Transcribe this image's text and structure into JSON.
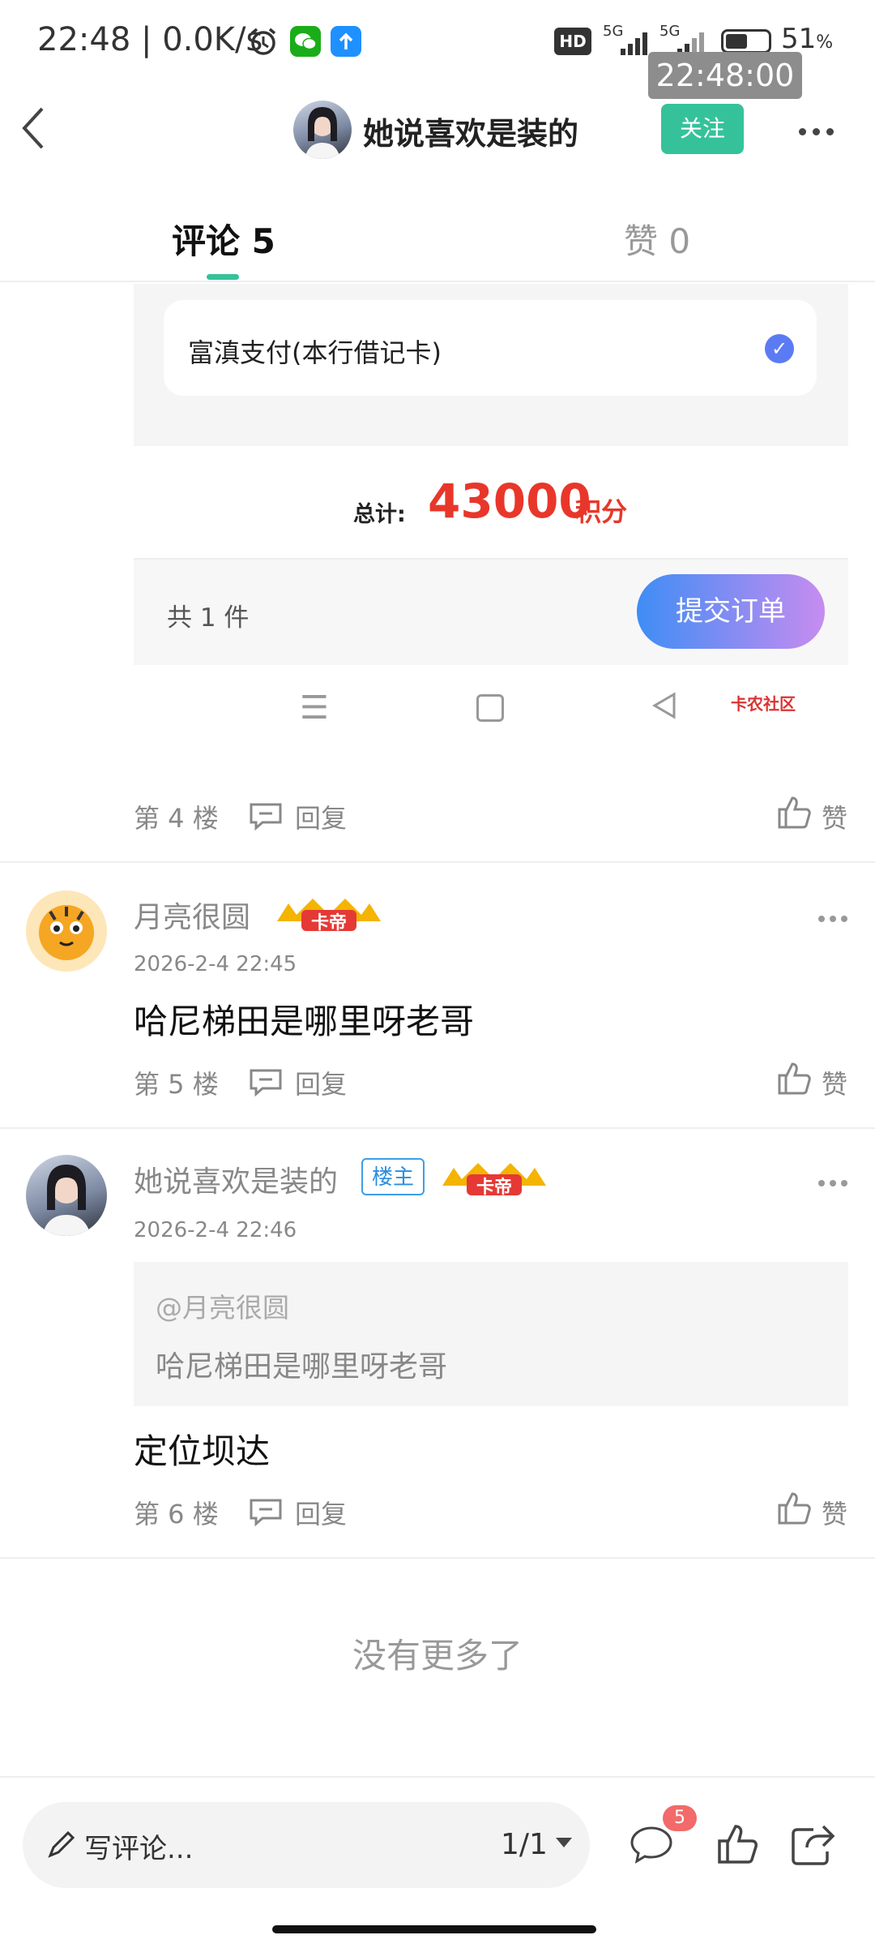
{
  "status_bar": {
    "time": "22:48",
    "net_speed": "0.0K/s",
    "hd": "HD",
    "signal1": "5G",
    "signal2": "5G",
    "battery": "51",
    "battery_unit": "%",
    "clock_overlay": "22:48:00"
  },
  "header": {
    "title": "她说喜欢是装的",
    "follow_label": "关注"
  },
  "tabs": [
    {
      "label": "评论 5",
      "active": true
    },
    {
      "label": "赞 0",
      "active": false
    }
  ],
  "embedded": {
    "payment_method": "富滇支付(本行借记卡)",
    "total_label": "总计:",
    "total_value": "43000",
    "total_unit": "积分",
    "item_count": "共 1 件",
    "submit_label": "提交订单",
    "watermark": "卡农社区"
  },
  "comments": [
    {
      "floor": "第 4 楼",
      "reply_label": "回复",
      "like_label": "赞"
    },
    {
      "user": "月亮很圆",
      "badge": "卡帝",
      "date": "2026-2-4 22:45",
      "text": "哈尼梯田是哪里呀老哥",
      "floor": "第 5 楼",
      "reply_label": "回复",
      "like_label": "赞"
    },
    {
      "user": "她说喜欢是装的",
      "tag": "楼主",
      "badge": "卡帝",
      "date": "2026-2-4 22:46",
      "quote_user": "@月亮很圆",
      "quote_text": "哈尼梯田是哪里呀老哥",
      "text": "定位坝达",
      "floor": "第 6 楼",
      "reply_label": "回复",
      "like_label": "赞"
    }
  ],
  "no_more": "没有更多了",
  "bottom_bar": {
    "write_placeholder": "写评论...",
    "page_indicator": "1/1",
    "comment_count": "5"
  },
  "colors": {
    "accent": "#35c29a",
    "price_red": "#e8372a",
    "badge_red": "#f26a6a",
    "host_blue": "#2a8ee0"
  }
}
